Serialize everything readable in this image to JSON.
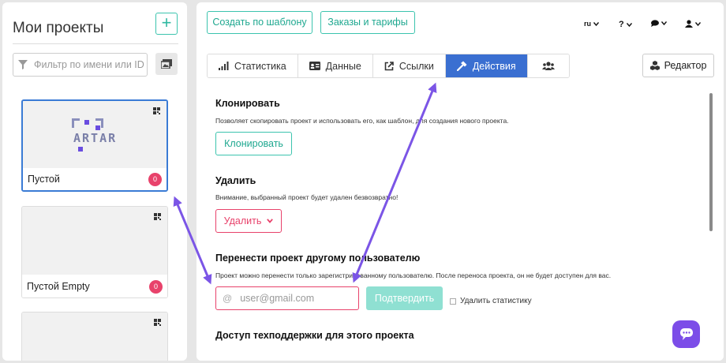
{
  "left_panel": {
    "title": "Мои проекты",
    "add_label": "+",
    "filter_placeholder": "Фильтр по имени или ID",
    "projects": [
      {
        "name": "Пустой",
        "badge": "0",
        "logo_text": "ARTAR",
        "selected": true
      },
      {
        "name": "Пустой Empty",
        "badge": "0",
        "selected": false
      },
      {
        "name": "",
        "badge": "",
        "selected": false
      }
    ]
  },
  "header": {
    "template_button": "Создать по шаблону",
    "orders_button": "Заказы и тарифы",
    "lang": "ru",
    "help": "?"
  },
  "tabs": [
    {
      "label": "Статистика",
      "icon": "bar-chart-icon",
      "active": false
    },
    {
      "label": "Данные",
      "icon": "id-card-icon",
      "active": false
    },
    {
      "label": "Ссылки",
      "icon": "external-link-icon",
      "active": false
    },
    {
      "label": "Действия",
      "icon": "hammer-icon",
      "active": true
    },
    {
      "label": "",
      "icon": "users-icon",
      "active": false
    }
  ],
  "editor_button": "Редактор",
  "sections": {
    "clone": {
      "title": "Клонировать",
      "desc": "Позволяет скопировать проект и использовать его, как шаблон, для создания нового проекта.",
      "button": "Клонировать"
    },
    "delete": {
      "title": "Удалить",
      "desc": "Внимание, выбранный проект будет удален безвозвратно!",
      "button": "Удалить"
    },
    "transfer": {
      "title": "Перенести проект другому пользователю",
      "desc": "Проект можно перенести только зарегистрированному пользователю. После переноса проекта, он не будет доступен для вас.",
      "email_placeholder": "user@gmail.com",
      "confirm": "Подтвердить",
      "delete_stats": "Удалить статистику"
    },
    "support": {
      "title": "Доступ техподдержки для этого проекта"
    }
  },
  "colors": {
    "teal": "#3cc4ae",
    "blue": "#3a6fd1",
    "pink": "#e8426b",
    "purple_arrow": "#7b55e6",
    "chat": "#7c4de8"
  }
}
